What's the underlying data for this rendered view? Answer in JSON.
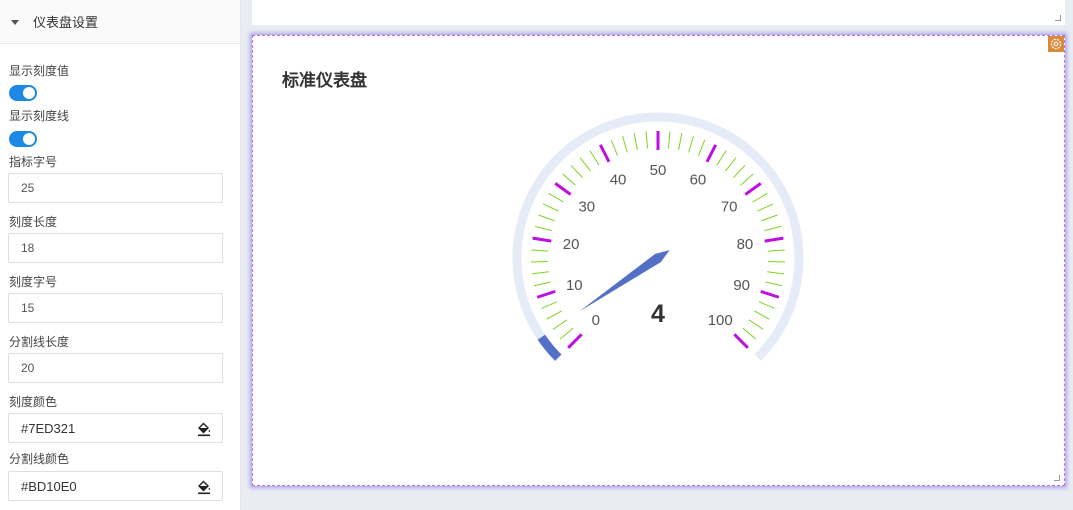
{
  "panel": {
    "title": "仪表盘设置",
    "fields": {
      "show_tick_value_label": "显示刻度值",
      "show_tick_line_label": "显示刻度线",
      "indicator_font_size_label": "指标字号",
      "indicator_font_size_value": "25",
      "tick_length_label": "刻度长度",
      "tick_length_value": "18",
      "tick_font_size_label": "刻度字号",
      "tick_font_size_value": "15",
      "split_line_length_label": "分割线长度",
      "split_line_length_value": "20",
      "tick_color_label": "刻度颜色",
      "tick_color_value": "#7ED321",
      "split_line_color_label": "分割线颜色",
      "split_line_color_value": "#BD10E0"
    },
    "toggles": {
      "show_tick_value": true,
      "show_tick_line": true
    },
    "icons": {
      "collapse": "caret-down-icon",
      "color_picker": "paint-bucket-icon"
    }
  },
  "card": {
    "title": "标准仪表盘",
    "icons": {
      "settings": "gear-icon"
    }
  },
  "colors": {
    "accent": "#1e88e5",
    "tick_color": "#7ED321",
    "split_color": "#BD10E0",
    "progress": "#5470c6",
    "track": "#e6ebf8"
  },
  "gauge": {
    "min": 0,
    "max": 100,
    "value": 4,
    "value_label": "4",
    "labels": [
      "0",
      "10",
      "20",
      "30",
      "40",
      "50",
      "60",
      "70",
      "80",
      "90",
      "100"
    ]
  }
}
